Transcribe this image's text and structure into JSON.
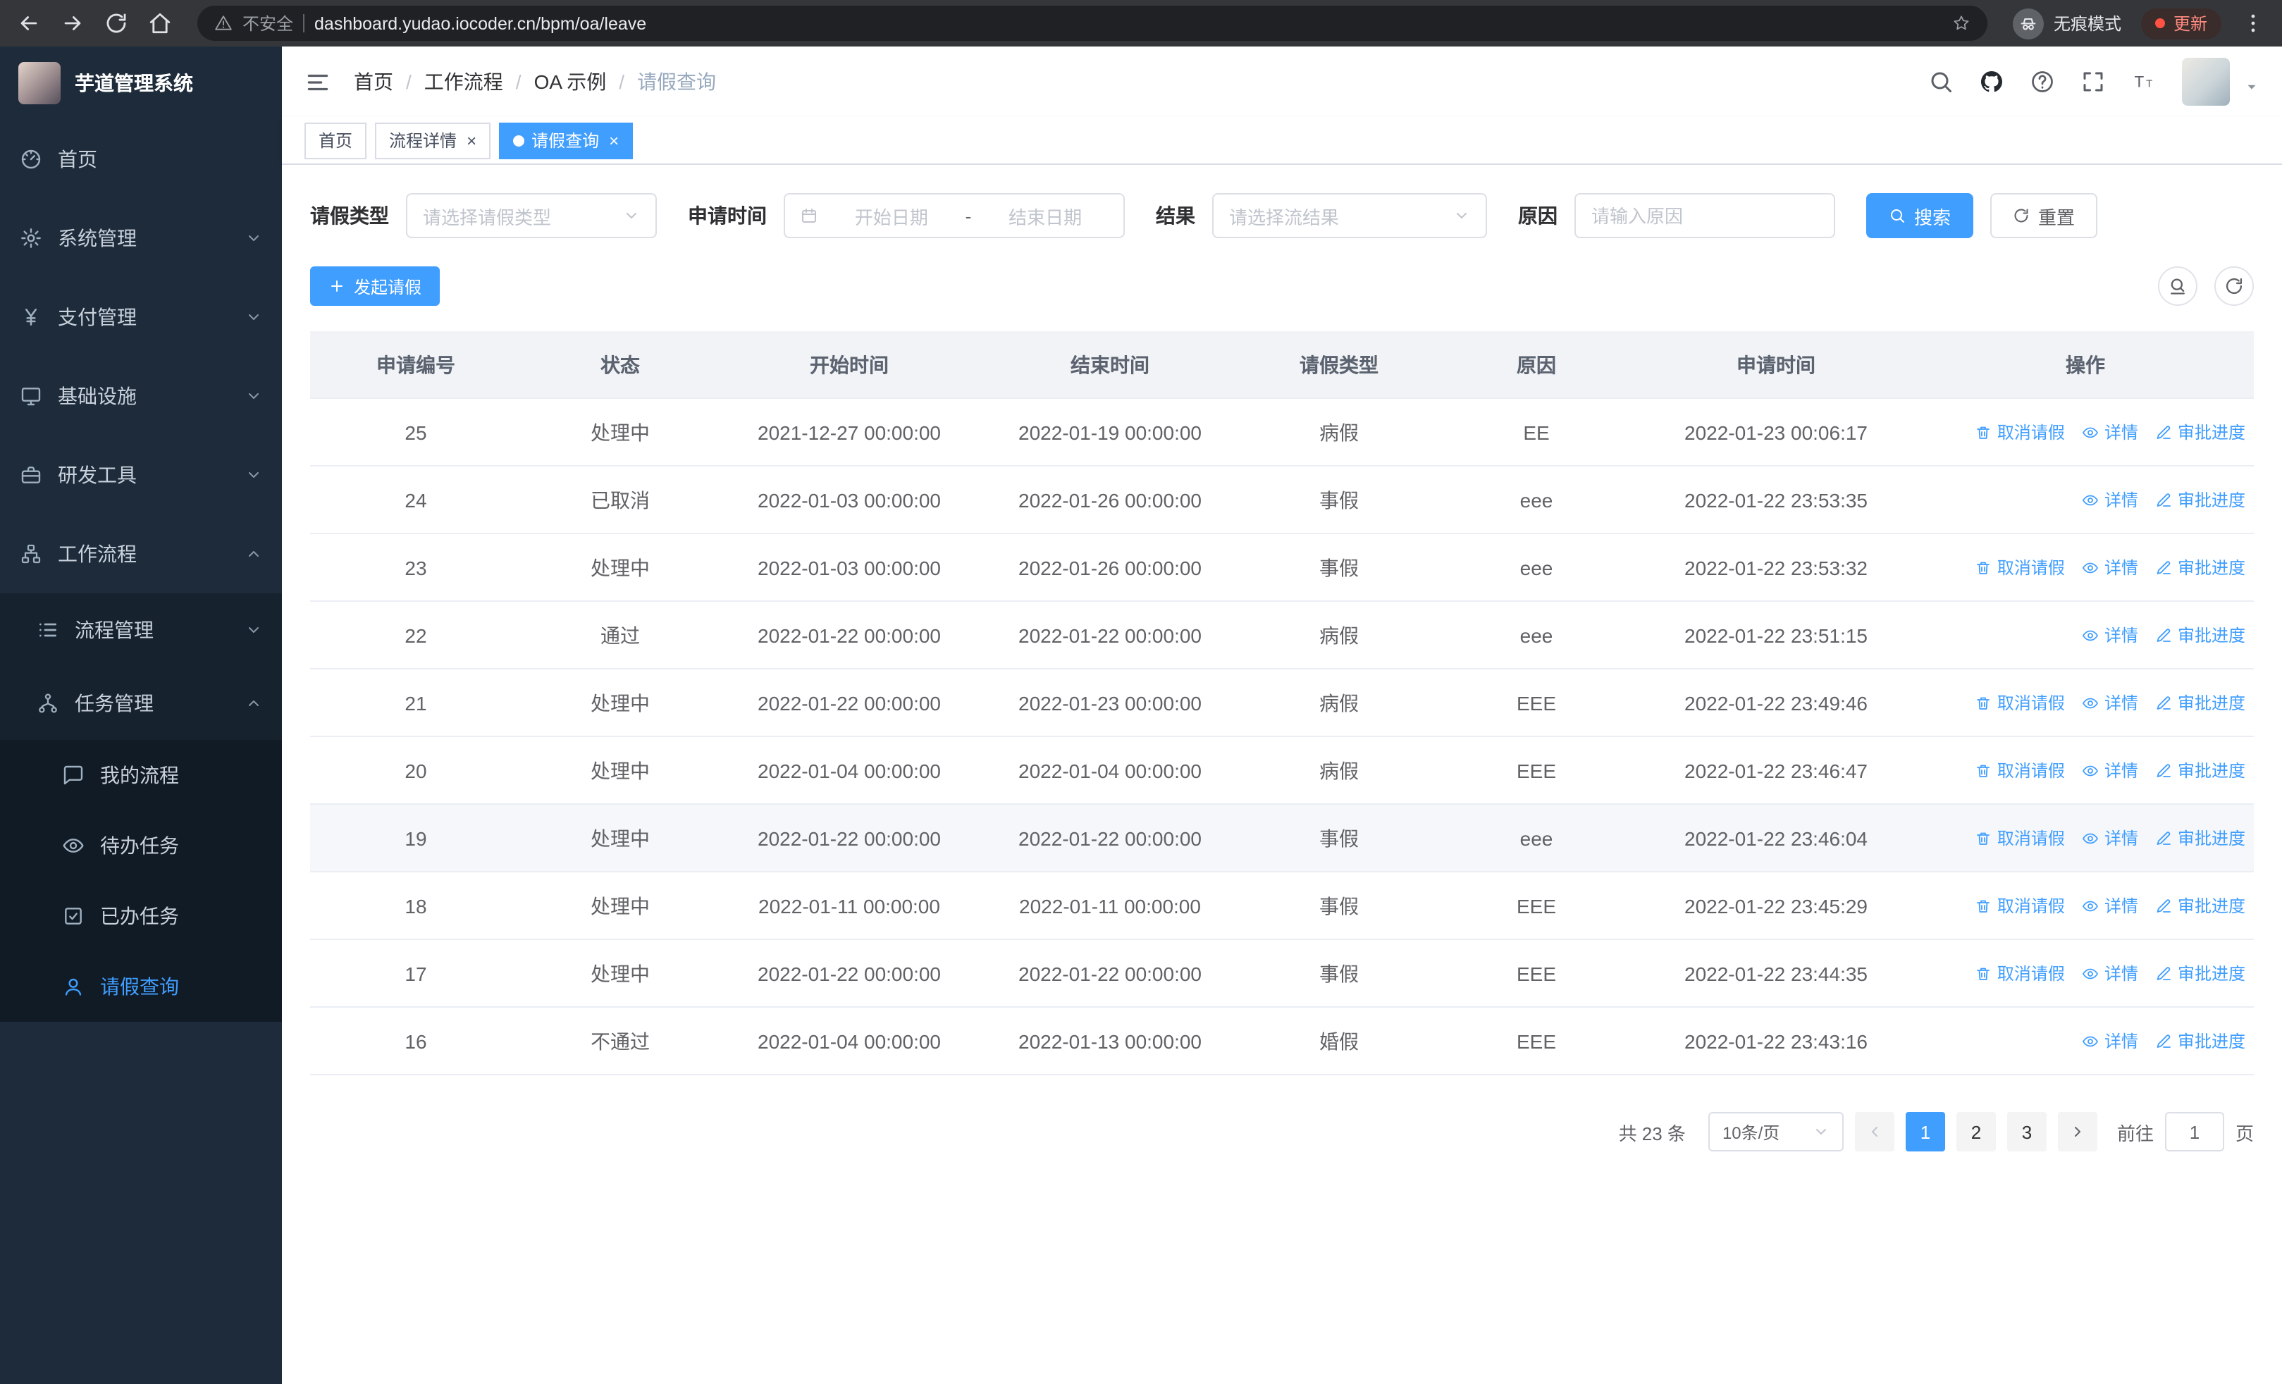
{
  "browser": {
    "security_label": "不安全",
    "url": "dashboard.yudao.iocoder.cn/bpm/oa/leave",
    "incognito_label": "无痕模式",
    "update_label": "更新"
  },
  "sidebar": {
    "logo_title": "芋道管理系统",
    "menu": [
      {
        "label": "首页",
        "icon": "dashboard"
      },
      {
        "label": "系统管理",
        "icon": "gear",
        "expandable": true
      },
      {
        "label": "支付管理",
        "icon": "yen",
        "expandable": true
      },
      {
        "label": "基础设施",
        "icon": "monitor",
        "expandable": true
      },
      {
        "label": "研发工具",
        "icon": "briefcase",
        "expandable": true
      },
      {
        "label": "工作流程",
        "icon": "workflow",
        "expandable": true,
        "expanded": true,
        "children": [
          {
            "label": "流程管理",
            "icon": "tree",
            "expandable": true
          },
          {
            "label": "任务管理",
            "icon": "branch",
            "expandable": true,
            "expanded": true,
            "children": [
              {
                "label": "我的流程",
                "icon": "chat"
              },
              {
                "label": "待办任务",
                "icon": "eye"
              },
              {
                "label": "已办任务",
                "icon": "check-square"
              },
              {
                "label": "请假查询",
                "icon": "user",
                "active": true
              }
            ]
          }
        ]
      }
    ]
  },
  "header": {
    "breadcrumb": [
      "首页",
      "工作流程",
      "OA 示例",
      "请假查询"
    ]
  },
  "tabs": [
    {
      "label": "首页",
      "closable": false,
      "active": false
    },
    {
      "label": "流程详情",
      "closable": true,
      "active": false
    },
    {
      "label": "请假查询",
      "closable": true,
      "active": true
    }
  ],
  "filters": {
    "leave_type_label": "请假类型",
    "leave_type_placeholder": "请选择请假类型",
    "apply_time_label": "申请时间",
    "start_date_placeholder": "开始日期",
    "range_separator": "-",
    "end_date_placeholder": "结束日期",
    "result_label": "结果",
    "result_placeholder": "请选择流结果",
    "reason_label": "原因",
    "reason_placeholder": "请输入原因",
    "search_button": "搜索",
    "reset_button": "重置"
  },
  "toolbar": {
    "create_button": "发起请假"
  },
  "table": {
    "columns": [
      "申请编号",
      "状态",
      "开始时间",
      "结束时间",
      "请假类型",
      "原因",
      "申请时间",
      "操作"
    ],
    "actions": {
      "cancel": "取消请假",
      "detail": "详情",
      "progress": "审批进度"
    },
    "rows": [
      {
        "id": "25",
        "status": "处理中",
        "start": "2021-12-27 00:00:00",
        "end": "2022-01-19 00:00:00",
        "type": "病假",
        "reason": "EE",
        "applied": "2022-01-23 00:06:17",
        "cancellable": true
      },
      {
        "id": "24",
        "status": "已取消",
        "start": "2022-01-03 00:00:00",
        "end": "2022-01-26 00:00:00",
        "type": "事假",
        "reason": "eee",
        "applied": "2022-01-22 23:53:35",
        "cancellable": false
      },
      {
        "id": "23",
        "status": "处理中",
        "start": "2022-01-03 00:00:00",
        "end": "2022-01-26 00:00:00",
        "type": "事假",
        "reason": "eee",
        "applied": "2022-01-22 23:53:32",
        "cancellable": true
      },
      {
        "id": "22",
        "status": "通过",
        "start": "2022-01-22 00:00:00",
        "end": "2022-01-22 00:00:00",
        "type": "病假",
        "reason": "eee",
        "applied": "2022-01-22 23:51:15",
        "cancellable": false
      },
      {
        "id": "21",
        "status": "处理中",
        "start": "2022-01-22 00:00:00",
        "end": "2022-01-23 00:00:00",
        "type": "病假",
        "reason": "EEE",
        "applied": "2022-01-22 23:49:46",
        "cancellable": true
      },
      {
        "id": "20",
        "status": "处理中",
        "start": "2022-01-04 00:00:00",
        "end": "2022-01-04 00:00:00",
        "type": "病假",
        "reason": "EEE",
        "applied": "2022-01-22 23:46:47",
        "cancellable": true
      },
      {
        "id": "19",
        "status": "处理中",
        "start": "2022-01-22 00:00:00",
        "end": "2022-01-22 00:00:00",
        "type": "事假",
        "reason": "eee",
        "applied": "2022-01-22 23:46:04",
        "cancellable": true,
        "hover": true
      },
      {
        "id": "18",
        "status": "处理中",
        "start": "2022-01-11 00:00:00",
        "end": "2022-01-11 00:00:00",
        "type": "事假",
        "reason": "EEE",
        "applied": "2022-01-22 23:45:29",
        "cancellable": true
      },
      {
        "id": "17",
        "status": "处理中",
        "start": "2022-01-22 00:00:00",
        "end": "2022-01-22 00:00:00",
        "type": "事假",
        "reason": "EEE",
        "applied": "2022-01-22 23:44:35",
        "cancellable": true
      },
      {
        "id": "16",
        "status": "不通过",
        "start": "2022-01-04 00:00:00",
        "end": "2022-01-13 00:00:00",
        "type": "婚假",
        "reason": "EEE",
        "applied": "2022-01-22 23:43:16",
        "cancellable": false
      }
    ]
  },
  "pagination": {
    "total_text": "共 23 条",
    "page_size": "10条/页",
    "pages": [
      "1",
      "2",
      "3"
    ],
    "active_page": "1",
    "goto_label": "前往",
    "goto_value": "1",
    "goto_suffix": "页"
  }
}
